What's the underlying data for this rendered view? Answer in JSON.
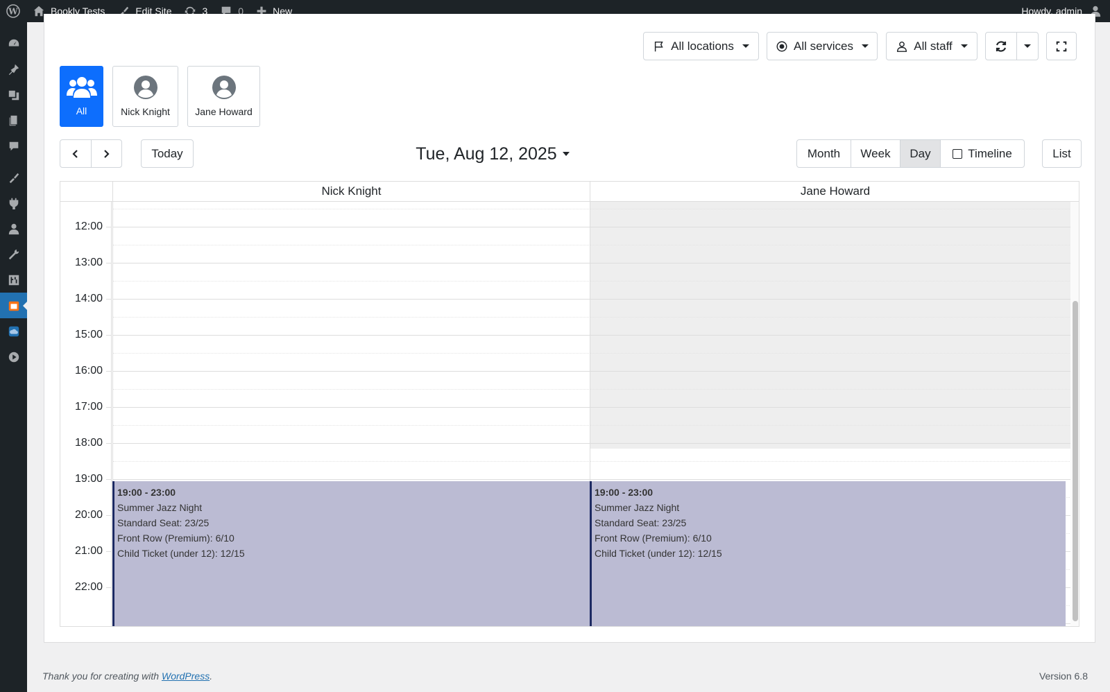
{
  "adminbar": {
    "site_name": "Bookly Tests",
    "edit_site": "Edit Site",
    "updates_count": "3",
    "comments_count": "0",
    "new_label": "New",
    "howdy": "Howdy, admin"
  },
  "filters": {
    "locations": "All locations",
    "services": "All services",
    "staff": "All staff"
  },
  "staff_tiles": [
    {
      "label": "All"
    },
    {
      "label": "Nick Knight"
    },
    {
      "label": "Jane Howard"
    }
  ],
  "nav": {
    "today": "Today",
    "date_title": "Tue, Aug 12, 2025"
  },
  "views": {
    "month": "Month",
    "week": "Week",
    "day": "Day",
    "timeline": "Timeline",
    "list": "List",
    "active": "Day"
  },
  "calendar": {
    "columns": [
      "Nick Knight",
      "Jane Howard"
    ],
    "times": [
      "12:00",
      "13:00",
      "14:00",
      "15:00",
      "16:00",
      "17:00",
      "18:00",
      "19:00",
      "20:00",
      "21:00",
      "22:00"
    ],
    "events": [
      {
        "time": "19:00 - 23:00",
        "title": "Summer Jazz Night",
        "line1": "Standard Seat: 23/25",
        "line2": "Front Row (Premium): 6/10",
        "line3": "Child Ticket (under 12): 12/15"
      },
      {
        "time": "19:00 - 23:00",
        "title": "Summer Jazz Night",
        "line1": "Standard Seat: 23/25",
        "line2": "Front Row (Premium): 6/10",
        "line3": "Child Ticket (under 12): 12/15"
      }
    ]
  },
  "footer": {
    "thanks_prefix": "Thank you for creating with ",
    "wordpress_link": "WordPress",
    "thanks_suffix": ".",
    "version": "Version 6.8"
  },
  "colors": {
    "accent": "#0d6efd",
    "event_bg": "#bbbbd3",
    "event_border": "#1d2a63",
    "admin_bar": "#1d2327"
  }
}
